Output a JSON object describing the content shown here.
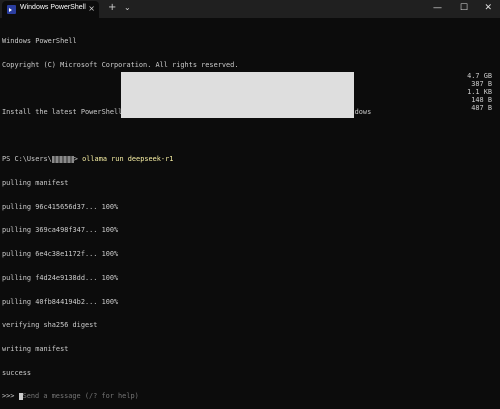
{
  "window": {
    "tab_title": "Windows PowerShell",
    "tab_close": "×",
    "new_tab": "+",
    "tab_dropdown": "⌄",
    "minimize": "—",
    "maximize": "☐",
    "close": "✕"
  },
  "terminal": {
    "banner_1": "Windows PowerShell",
    "banner_2": "Copyright (C) Microsoft Corporation. All rights reserved.",
    "install_msg": "Install the latest PowerShell for new features and improvements! https://aka.ms/PSWindows",
    "prompt_prefix": "PS C:\\Users\\",
    "prompt_suffix": "> ",
    "command": "ollama run deepseek-r1",
    "pulling_manifest": "pulling manifest",
    "layers": [
      {
        "label": "pulling 96c415656d37... 100%",
        "size": "4.7 GB"
      },
      {
        "label": "pulling 369ca498f347... 100%",
        "size": "387 B"
      },
      {
        "label": "pulling 6e4c38e1172f... 100%",
        "size": "1.1 KB"
      },
      {
        "label": "pulling f4d24e9138dd... 100%",
        "size": "148 B"
      },
      {
        "label": "pulling 40fb844194b2... 100%",
        "size": "487 B"
      }
    ],
    "verifying": "verifying sha256 digest",
    "writing": "writing manifest",
    "success": "success",
    "chat_prompt": ">>> ",
    "chat_placeholder": "Send a message (/? for help)"
  }
}
